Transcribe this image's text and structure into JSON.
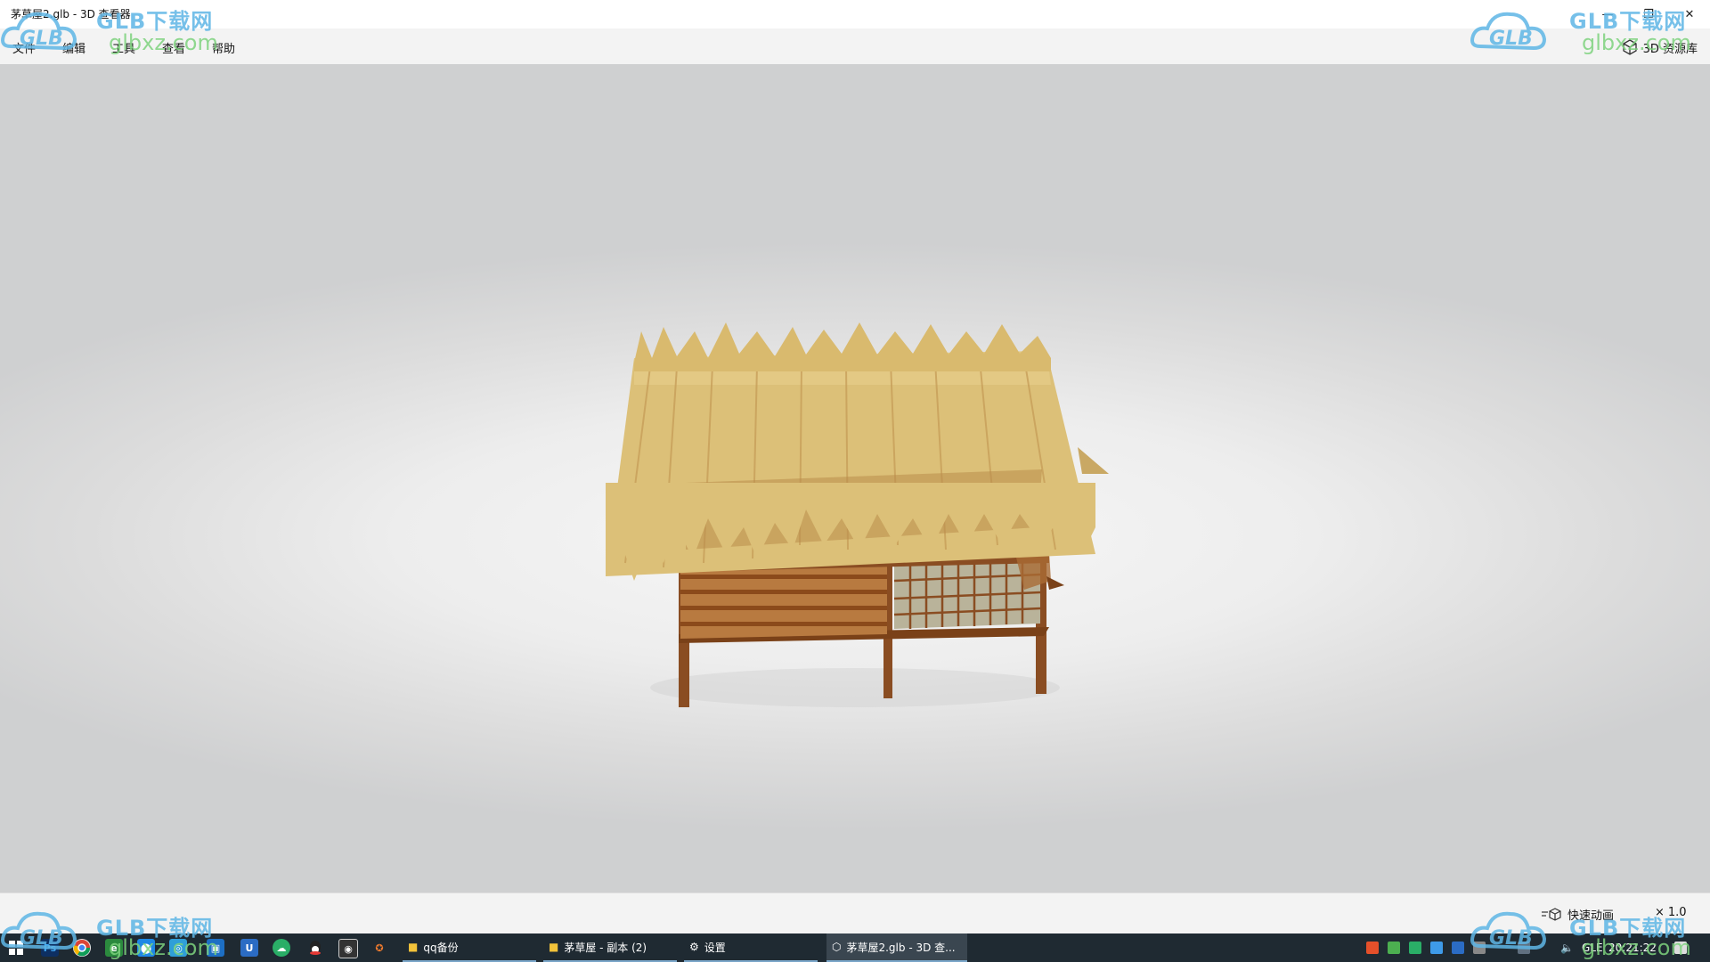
{
  "window": {
    "title": "茅草屋2.glb - 3D 查看器",
    "controls": {
      "minimize": "—",
      "maximize": "❐",
      "close": "✕"
    }
  },
  "menu": {
    "items": [
      "文件",
      "编辑",
      "工具",
      "查看",
      "帮助"
    ],
    "library_button": "3D 资源库"
  },
  "viewer": {
    "model_name": "茅草屋2.glb",
    "colors": {
      "thatch": "#dcc078",
      "wood": "#9a5a2c",
      "background": "#e8e8e8"
    }
  },
  "bottom": {
    "animation_label": "快速动画",
    "speed_prefix": "×",
    "speed_value": "1.0"
  },
  "taskbar": {
    "pinned_icons": [
      "windows-start",
      "photoshop",
      "chrome",
      "browser",
      "app",
      "app",
      "app",
      "wechat",
      "qq",
      "app",
      "blender"
    ],
    "tasks": [
      {
        "label": "qq备份",
        "icon": "folder-icon"
      },
      {
        "label": "茅草屋 - 副本 (2)",
        "icon": "folder-icon"
      },
      {
        "label": "设置",
        "icon": "gear-icon"
      },
      {
        "label": "茅草屋2.glb - 3D 查...",
        "icon": "cube-icon",
        "active": true
      }
    ],
    "tray_language": "GLE",
    "clock": "20:21:22"
  },
  "watermark": {
    "brand": "GLB下载网",
    "logo": "GLB",
    "url": "glbxz.com"
  }
}
